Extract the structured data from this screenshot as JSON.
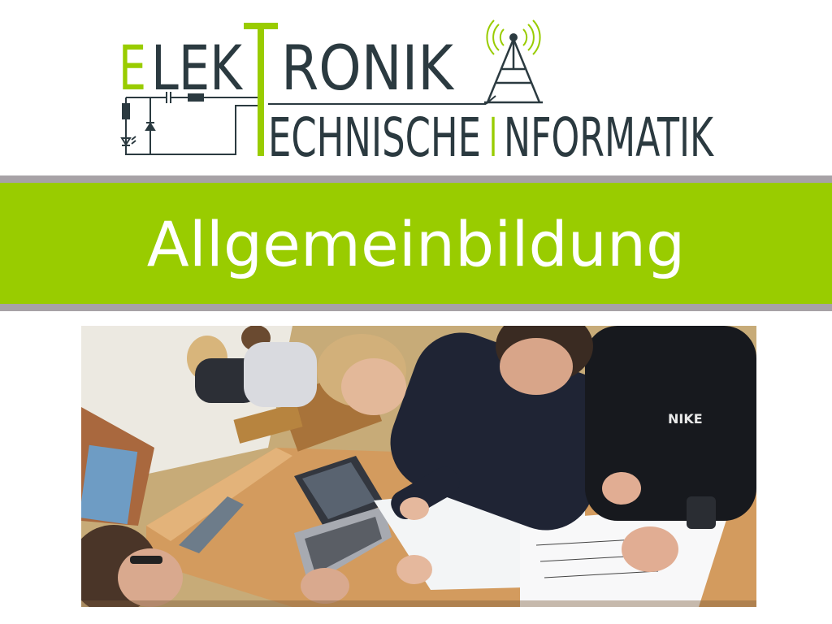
{
  "logo": {
    "line1_first": "E",
    "line1_mid": "LEK",
    "line1_t": "T",
    "line1_rest": "RONIK",
    "line2_part1": "ECHNISCHE",
    "line2_i": "I",
    "line2_part2": "NFORMATIK",
    "colors": {
      "accent": "#99cc00",
      "dark": "#2b3a40"
    },
    "icons": [
      "antenna-icon",
      "circuit-icon"
    ]
  },
  "banner": {
    "title": "Allgemeinbildung",
    "colors": {
      "background": "#99cc00",
      "stripe": "#a7a2a6",
      "text": "#ffffff"
    }
  },
  "photo": {
    "description_icon": "classroom-photo",
    "brand_text": "NIKE"
  }
}
